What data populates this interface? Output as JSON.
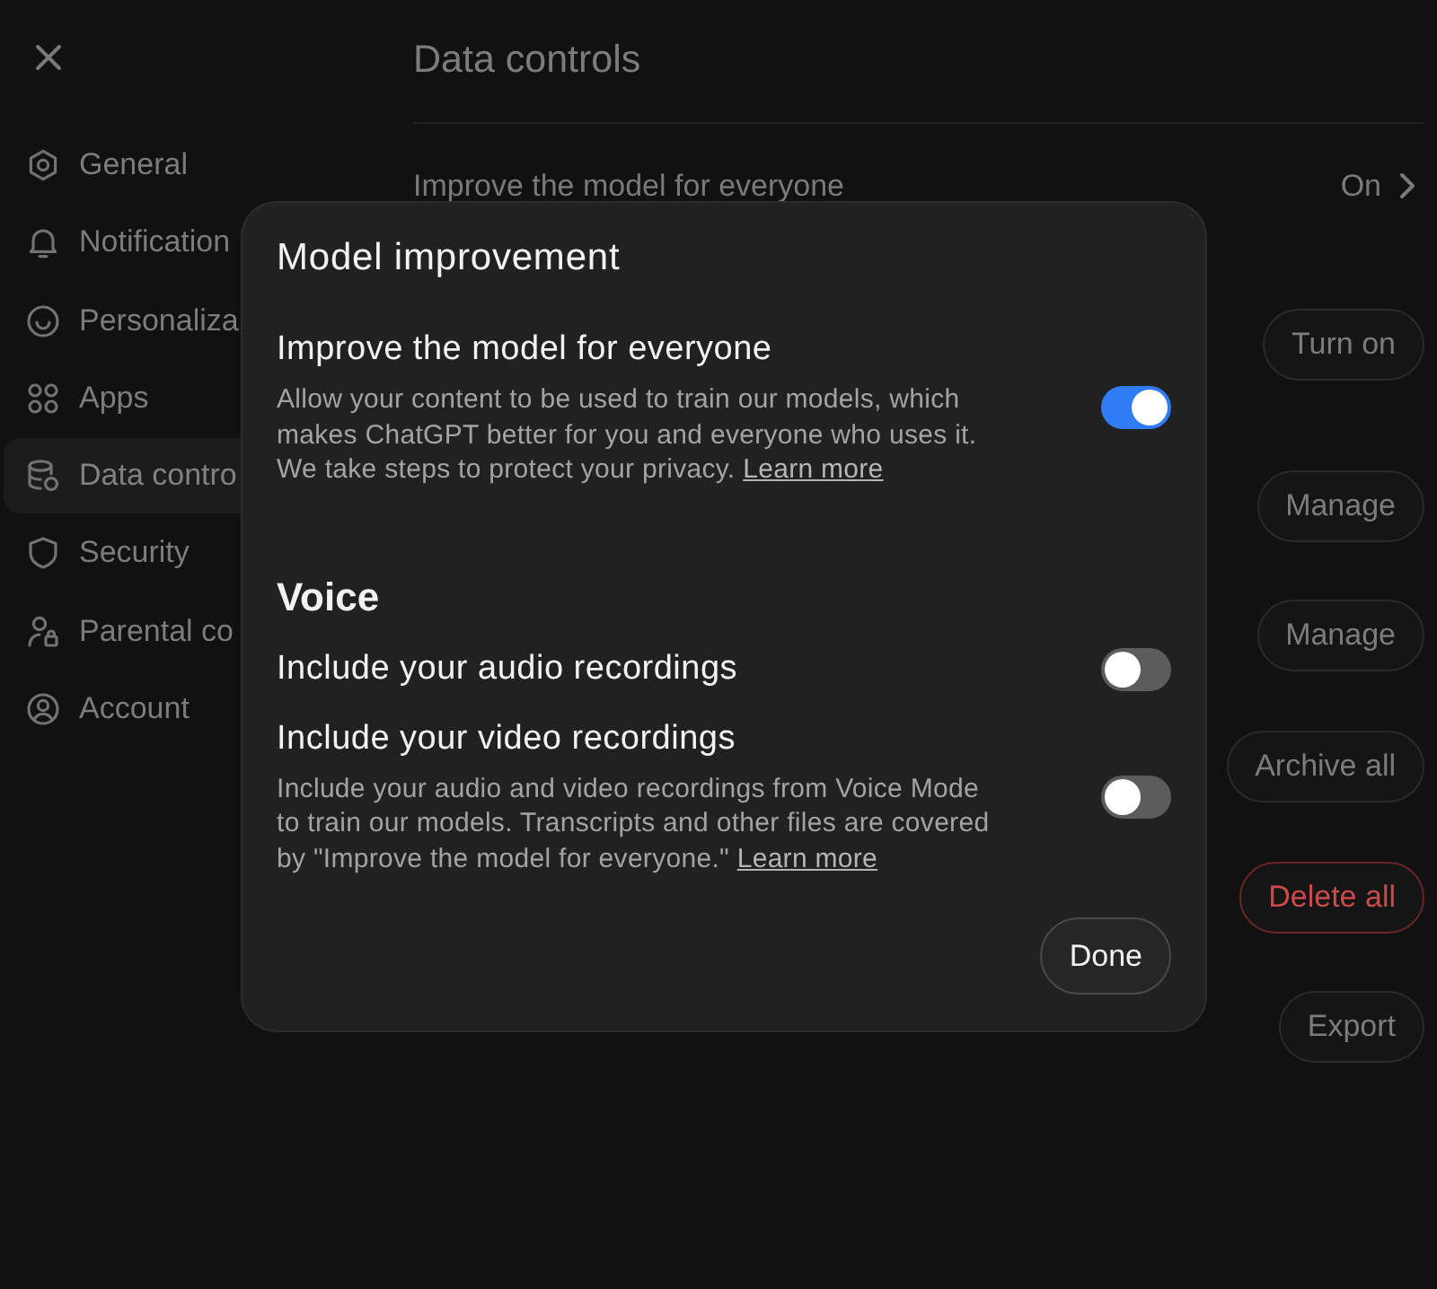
{
  "settings_page": {
    "sidebar": {
      "items": [
        {
          "label": "General",
          "selected": false
        },
        {
          "label": "Notification",
          "selected": false
        },
        {
          "label": "Personaliza",
          "selected": false
        },
        {
          "label": "Apps",
          "selected": false
        },
        {
          "label": "Data contro",
          "selected": true
        },
        {
          "label": "Security",
          "selected": false
        },
        {
          "label": "Parental co",
          "selected": false
        },
        {
          "label": "Account",
          "selected": false
        }
      ]
    },
    "title": "Data controls",
    "rows": [
      {
        "label": "Improve the model for everyone",
        "value": "On"
      }
    ],
    "buttons": [
      {
        "label": "Turn on",
        "kind": "default"
      },
      {
        "label": "Manage",
        "kind": "default"
      },
      {
        "label": "Manage",
        "kind": "default"
      },
      {
        "label": "Archive all",
        "kind": "default"
      },
      {
        "label": "Delete all",
        "kind": "danger"
      },
      {
        "label": "Export",
        "kind": "default"
      }
    ]
  },
  "dialog": {
    "title": "Model improvement",
    "sections": [
      {
        "settings": [
          {
            "title": "Improve the model for everyone",
            "description": "Allow your content to be used to train our models, which makes ChatGPT better for you and everyone who uses it. We take steps to protect your privacy.",
            "link": "Learn more",
            "on": true
          }
        ]
      },
      {
        "heading": "Voice",
        "settings": [
          {
            "title": "Include your audio recordings",
            "on": false
          },
          {
            "title": "Include your video recordings",
            "description": "Include your audio and video recordings from Voice Mode to train our models. Transcripts and other files are covered by \"Improve the model for everyone.\"",
            "link": "Learn more",
            "on": false
          }
        ]
      }
    ],
    "done_button": "Done"
  }
}
